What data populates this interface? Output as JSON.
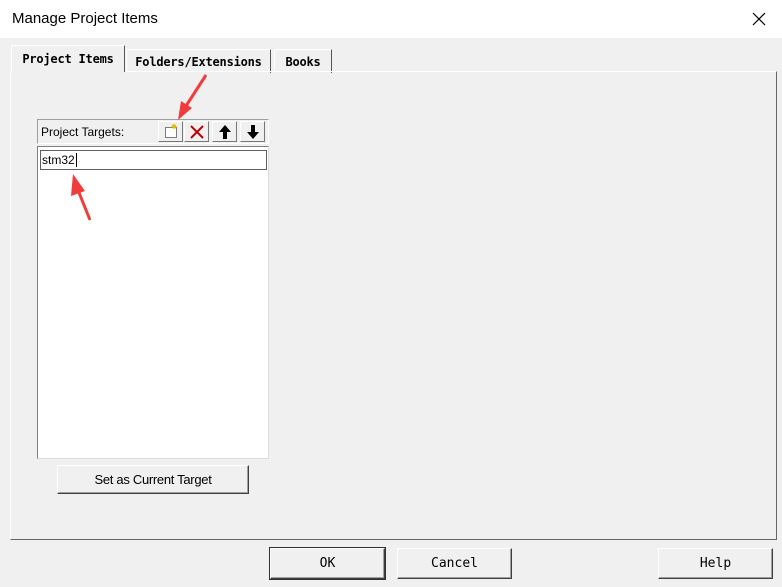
{
  "window": {
    "title": "Manage Project Items"
  },
  "tabs": [
    {
      "label": "Project Items",
      "active": true
    },
    {
      "label": "Folders/Extensions",
      "active": false
    },
    {
      "label": "Books",
      "active": false
    }
  ],
  "project_targets": {
    "label": "Project Targets:",
    "toolbar_icons": [
      "new-icon",
      "delete-icon",
      "move-up-icon",
      "move-down-icon"
    ],
    "items": [
      {
        "value": "stm32",
        "editing": true
      }
    ],
    "set_current_label": "Set as Current Target"
  },
  "footer": {
    "ok_label": "OK",
    "cancel_label": "Cancel",
    "help_label": "Help"
  },
  "annotation_color": "#f03c3c"
}
